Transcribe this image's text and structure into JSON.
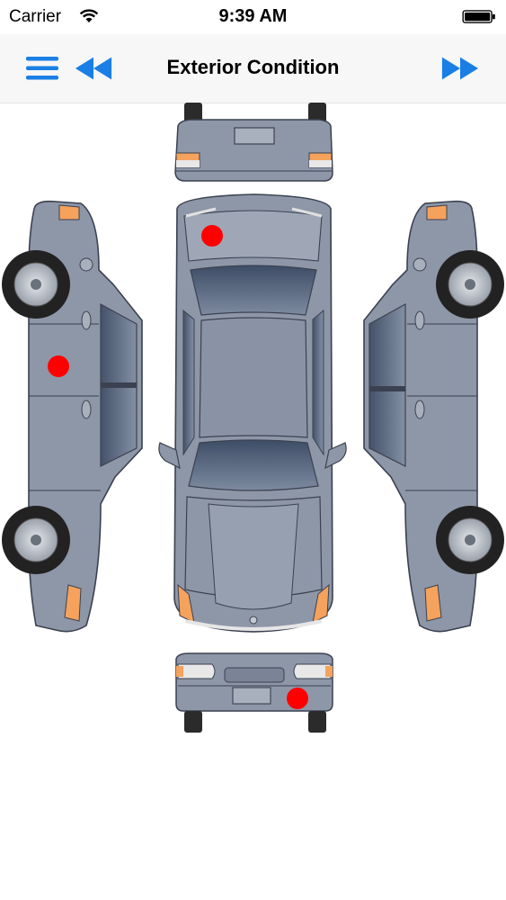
{
  "status_bar": {
    "carrier": "Carrier",
    "time": "9:39 AM"
  },
  "nav": {
    "title": "Exterior Condition",
    "menu_icon": "hamburger-menu-icon",
    "back_icon": "rewind-icon",
    "forward_icon": "fast-forward-icon",
    "accent_color": "#1a7fe5"
  },
  "diagram": {
    "views": [
      "front",
      "left-side",
      "top",
      "right-side",
      "rear"
    ],
    "car_color": "#8e97a8",
    "damage_marker_color": "#ff0000",
    "damage_markers": [
      {
        "view": "top",
        "area": "hood-left"
      },
      {
        "view": "left-side",
        "area": "rear-door"
      },
      {
        "view": "rear",
        "area": "rear-bumper-right"
      }
    ]
  }
}
